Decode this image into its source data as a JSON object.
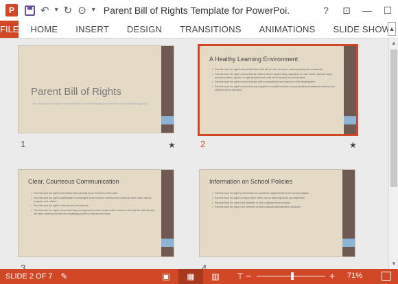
{
  "window": {
    "title": "Parent Bill of Rights Template for PowerPoi...",
    "app_icon_letter": "P"
  },
  "qat": {
    "undo_glyph": "↶",
    "undo_menu_glyph": "▾",
    "redo_glyph": "↻",
    "present_glyph": "⊙",
    "customize_glyph": "▾"
  },
  "window_controls": {
    "help": "?",
    "ribbon_options": "⊡",
    "minimize": "—",
    "maximize": "☐"
  },
  "ribbon": {
    "file_label": "FILE",
    "tabs": [
      "HOME",
      "INSERT",
      "DESIGN",
      "TRANSITIONS",
      "ANIMATIONS",
      "SLIDE SHOW"
    ],
    "collapse_glyph": "▲"
  },
  "slides": [
    {
      "number": "1",
      "title": "Parent Bill of Rights",
      "subtitle": "Sed ullamcorper turpis in erat bibendum, sit amet fringilla dolor pulvinar. Sed blandit feugiat elit."
    },
    {
      "number": "2",
      "title": "A Healthy Learning Environment",
      "bullets": [
        "Parents have the right to know that their child will be safe at school, both physically and emotionally.",
        "Parents have the right to know that all children will be treated fairly regardless of race, creed, national origin, economic status, gender, or age and that each child will be treated as an individual.",
        "Parents have the right to know that the staff is experienced and trained in child development.",
        "Parents have the right to know that any negative or unsafe behavior among students or between students and staff will not be tolerated."
      ]
    },
    {
      "number": "3",
      "title": "Clear, Courteous Communication",
      "bullets": [
        "Parents have the right to be treated with courtesy by all members of the staff.",
        "Parents have the right to participate in meaningful parent-teacher conferences to discuss their child's school progress and welfare.",
        "Parents have the right to visit schools and classes.",
        "Parents have the right to know that they can approach a staff member with a concern and that the staff member will listen carefully and will do everything possible to address the issue."
      ]
    },
    {
      "number": "4",
      "title": "Information on School Policies",
      "bullets": [
        "Parents have the right to information on academic requirements of the school program.",
        "Parents have the right to respect their child's record and respond to any statement.",
        "Parents have the right to be informed of and to appeal school policies.",
        "Parents have the right to be informed of and to appeal administrative decisions."
      ]
    }
  ],
  "slide_star": "★",
  "scrollbar": {
    "up": "▲",
    "down": "▼"
  },
  "status": {
    "slide_text": "SLIDE 2 OF 7",
    "notes_glyph": "✎",
    "view_normal": "▣",
    "view_sorter": "▦",
    "view_reading": "▥",
    "view_slideshow": "⊤",
    "zoom_minus": "−",
    "zoom_plus": "+",
    "zoom_value": "71%",
    "zoom_fraction": 0.52
  },
  "colors": {
    "accent": "#d24726",
    "slide_bg": "#e5dac6",
    "slide_bar": "#6e5a53",
    "slide_bar_accent": "#8db3d6"
  }
}
